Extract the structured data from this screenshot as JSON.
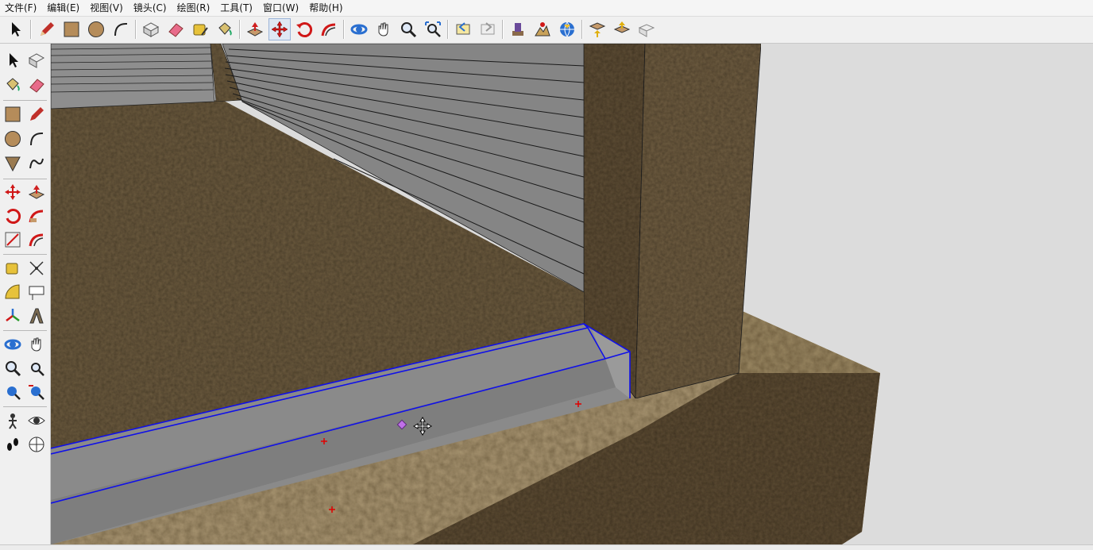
{
  "menu": [
    {
      "id": "file",
      "label": "文件(F)"
    },
    {
      "id": "edit",
      "label": "编辑(E)"
    },
    {
      "id": "view",
      "label": "视图(V)"
    },
    {
      "id": "camera",
      "label": "镜头(C)"
    },
    {
      "id": "draw",
      "label": "绘图(R)"
    },
    {
      "id": "tools",
      "label": "工具(T)"
    },
    {
      "id": "window",
      "label": "窗口(W)"
    },
    {
      "id": "help",
      "label": "帮助(H)"
    }
  ],
  "toolbar_icons": [
    "select",
    "pencil",
    "rectangle",
    "circle",
    "arc",
    "make-component",
    "eraser",
    "tape-measure",
    "paint-bucket",
    "push-pull",
    "move",
    "rotate",
    "follow-me",
    "orbit",
    "pan",
    "zoom",
    "zoom-extents",
    "previous-view",
    "next-view",
    "add-location",
    "toggle-terrain",
    "photo-textures",
    "get-models",
    "share-model",
    "share-component"
  ],
  "side_icons": [
    "select",
    "make-component",
    "paint-bucket",
    "eraser",
    "rectangle",
    "pencil",
    "circle",
    "arc",
    "polygon",
    "freehand",
    "move",
    "push-pull",
    "rotate",
    "follow-me",
    "scale",
    "offset",
    "tape-measure",
    "dimension",
    "protractor",
    "text",
    "axes",
    "3d-text",
    "orbit",
    "pan",
    "zoom",
    "zoom-window",
    "zoom-extents",
    "previous",
    "walk",
    "look-around",
    "position-camera",
    "section-plane"
  ],
  "colors": {
    "selection": "#1010e8",
    "ground": "#6b5a3e",
    "wood": "#6e5c40",
    "slab_top": "#a89571",
    "slab_side": "#5c4b33",
    "glass": "#8a8a8a",
    "sky": "#dcdcdc",
    "inference": "#e00000"
  }
}
